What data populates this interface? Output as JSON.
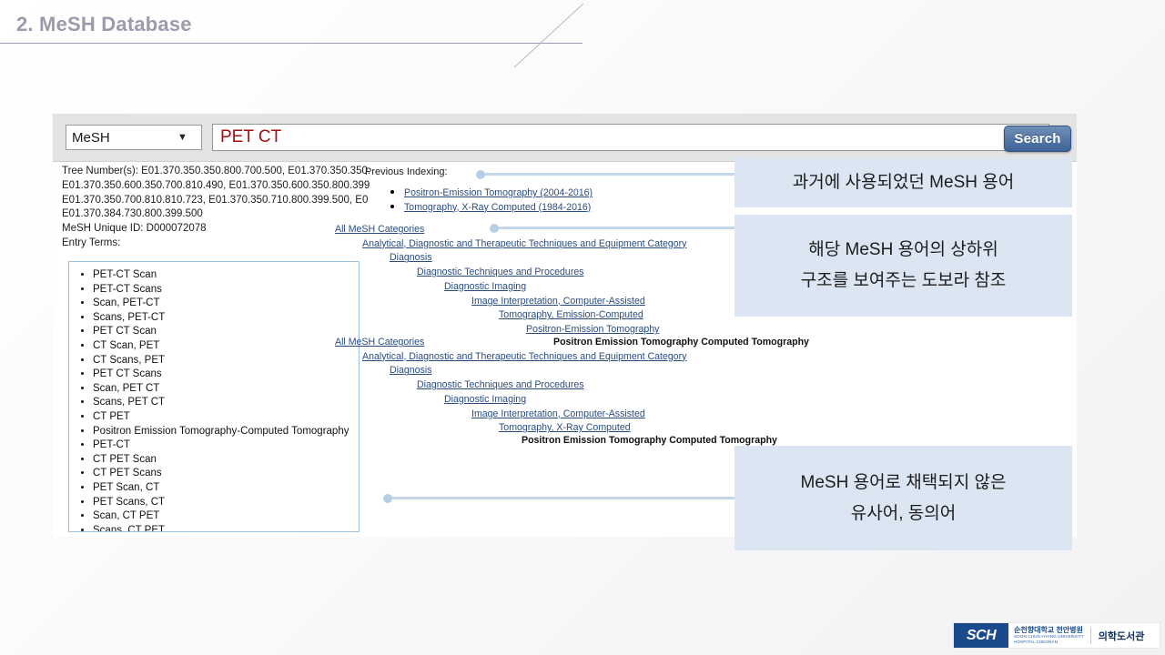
{
  "slide": {
    "title": "2. MeSH Database"
  },
  "search": {
    "database_value": "MeSH",
    "database_options": [
      "MeSH"
    ],
    "query_value": "PET CT",
    "query_placeholder": "",
    "search_button_label": "Search",
    "caret_icon": "chevron-down-icon"
  },
  "record": {
    "tree_numbers_lines": [
      "Tree Number(s): E01.370.350.350.800.700.500, E01.370.350.350.",
      "E01.370.350.600.350.700.810.490, E01.370.350.600.350.800.399",
      "E01.370.350.700.810.810.723, E01.370.350.710.800.399.500, E0",
      "E01.370.384.730.800.399.500"
    ],
    "unique_id_line": "MeSH Unique ID: D000072078",
    "entry_terms_label": "Entry Terms:",
    "entry_terms": [
      "PET-CT Scan",
      "PET-CT Scans",
      "Scan, PET-CT",
      "Scans, PET-CT",
      "PET CT Scan",
      "CT Scan, PET",
      "CT Scans, PET",
      "PET CT Scans",
      "Scan, PET CT",
      "Scans, PET CT",
      "CT PET",
      "Positron Emission Tomography-Computed Tomography",
      "PET-CT",
      "CT PET Scan",
      "CT PET Scans",
      "PET Scan, CT",
      "PET Scans, CT",
      "Scan, CT PET",
      "Scans, CT PET"
    ]
  },
  "previous_indexing": {
    "label": "Previous Indexing:",
    "items": [
      "Positron-Emission Tomography (2004-2016)",
      "Tomography, X-Ray Computed (1984-2016)"
    ]
  },
  "tree_1": {
    "nodes": [
      "All MeSH Categories",
      "Analytical, Diagnostic and Therapeutic Techniques and Equipment Category",
      "Diagnosis",
      "Diagnostic Techniques and Procedures",
      "Diagnostic Imaging",
      "Image Interpretation, Computer-Assisted",
      "Tomography, Emission-Computed",
      "Positron-Emission Tomography"
    ],
    "leaf": "Positron Emission Tomography Computed Tomography"
  },
  "tree_2": {
    "nodes": [
      "All MeSH Categories",
      "Analytical, Diagnostic and Therapeutic Techniques and Equipment Category",
      "Diagnosis",
      "Diagnostic Techniques and Procedures",
      "Diagnostic Imaging",
      "Image Interpretation, Computer-Assisted",
      "Tomography, X-Ray Computed"
    ],
    "leaf": "Positron Emission Tomography Computed Tomography"
  },
  "callouts": [
    {
      "lines": [
        "과거에 사용되었던 MeSH 용어"
      ]
    },
    {
      "lines": [
        "해당 MeSH 용어의 상하위",
        "구조를 보여주는 도보라 참조"
      ]
    },
    {
      "lines": [
        "MeSH 용어로 채택되지 않은",
        "유사어, 동의어"
      ]
    }
  ],
  "footer": {
    "mark": "SCH",
    "korean_line": "순천향대학교 천안병원",
    "english_line_1": "SOON CHUN HYANG UNIVERSITY",
    "english_line_2": "HOSPITAL CHEONAN",
    "library": "의학도서관"
  },
  "colors": {
    "title": "#9a9bac",
    "callout_bg": "#dce6f3",
    "link": "#2a4d80",
    "query_text": "#a01010",
    "search_button": "#3d6396",
    "brand": "#1b4a8c"
  }
}
